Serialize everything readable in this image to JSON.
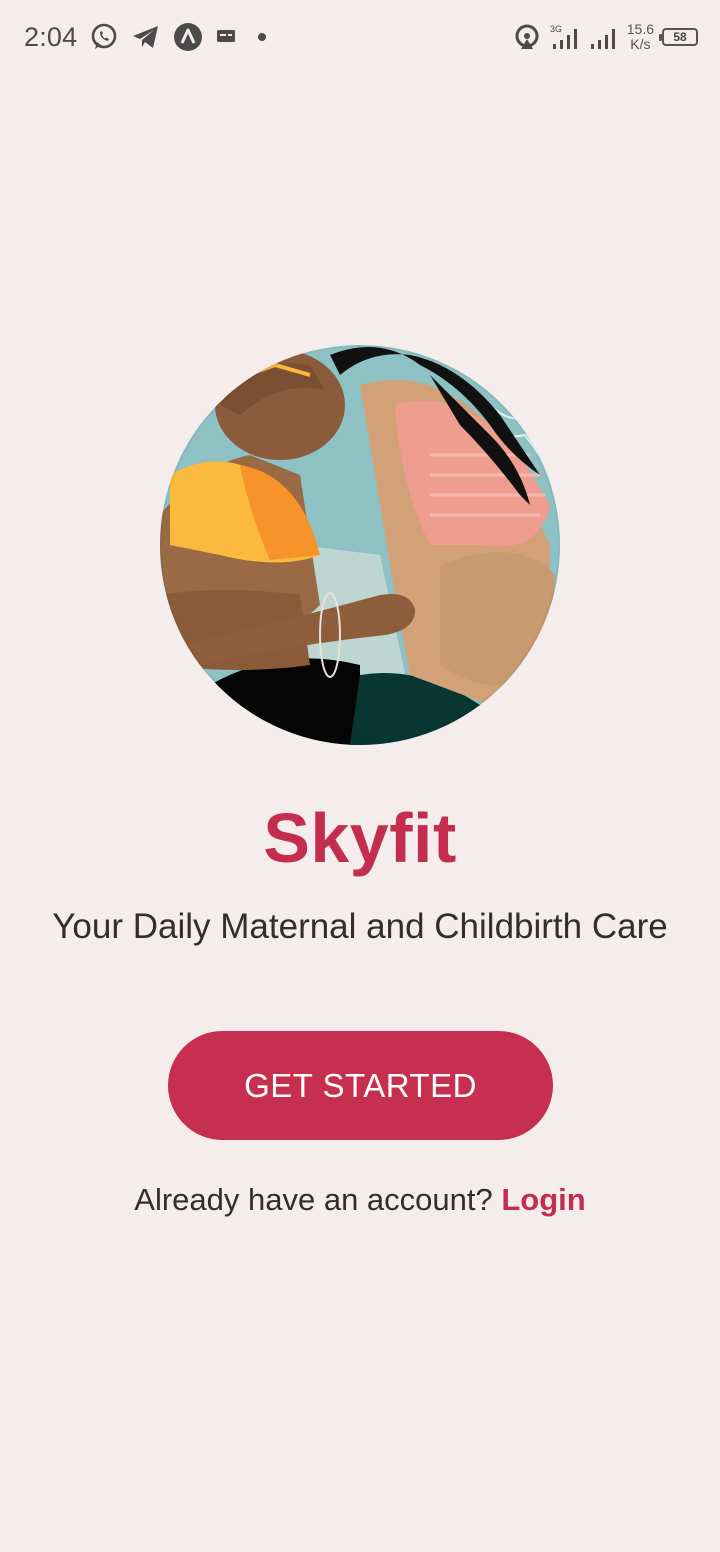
{
  "status_bar": {
    "time": "2:04",
    "icons_left": [
      "whatsapp-icon",
      "telegram-icon",
      "app-a-icon",
      "message-icon",
      "dot-icon"
    ],
    "net_speed_value": "15.6",
    "net_speed_unit": "K/s",
    "network_label": "3G",
    "battery_level": "58"
  },
  "main": {
    "brand_title": "Skyfit",
    "tagline": "Your Daily Maternal and Childbirth Care",
    "cta_label": "GET STARTED",
    "login_prompt": "Already have an account?",
    "login_link": "Login"
  },
  "colors": {
    "background": "#f5ecec",
    "brand": "#c32d50",
    "button": "#c72f4f",
    "text": "#2f2f2f"
  }
}
